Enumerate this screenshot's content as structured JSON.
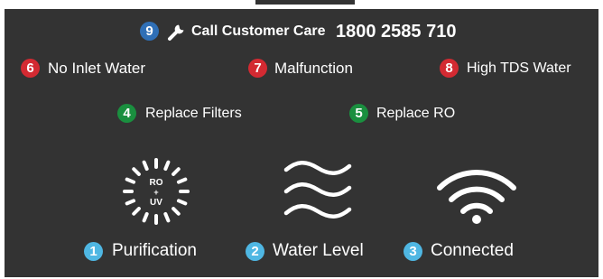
{
  "care": {
    "badge": "9",
    "label": "Call Customer Care",
    "phone": "1800 2585 710",
    "icon": "wrench-icon"
  },
  "alerts": [
    {
      "badge": "6",
      "label": "No Inlet Water"
    },
    {
      "badge": "7",
      "label": "Malfunction"
    },
    {
      "badge": "8",
      "label": "High TDS Water"
    }
  ],
  "maintenance": [
    {
      "badge": "4",
      "label": "Replace Filters"
    },
    {
      "badge": "5",
      "label": "Replace RO"
    }
  ],
  "status": [
    {
      "badge": "1",
      "label": "Purification",
      "icon": "purification-icon",
      "icon_text_top": "RO",
      "icon_text_mid": "+",
      "icon_text_bottom": "UV"
    },
    {
      "badge": "2",
      "label": "Water Level",
      "icon": "water-level-icon"
    },
    {
      "badge": "3",
      "label": "Connected",
      "icon": "wifi-icon"
    }
  ],
  "colors": {
    "panel": "#333333",
    "badge_blue": "#2f6fb6",
    "badge_red": "#d32a32",
    "badge_green": "#1a8f3f",
    "badge_light_blue": "#4fb7e3",
    "text": "#ffffff"
  }
}
